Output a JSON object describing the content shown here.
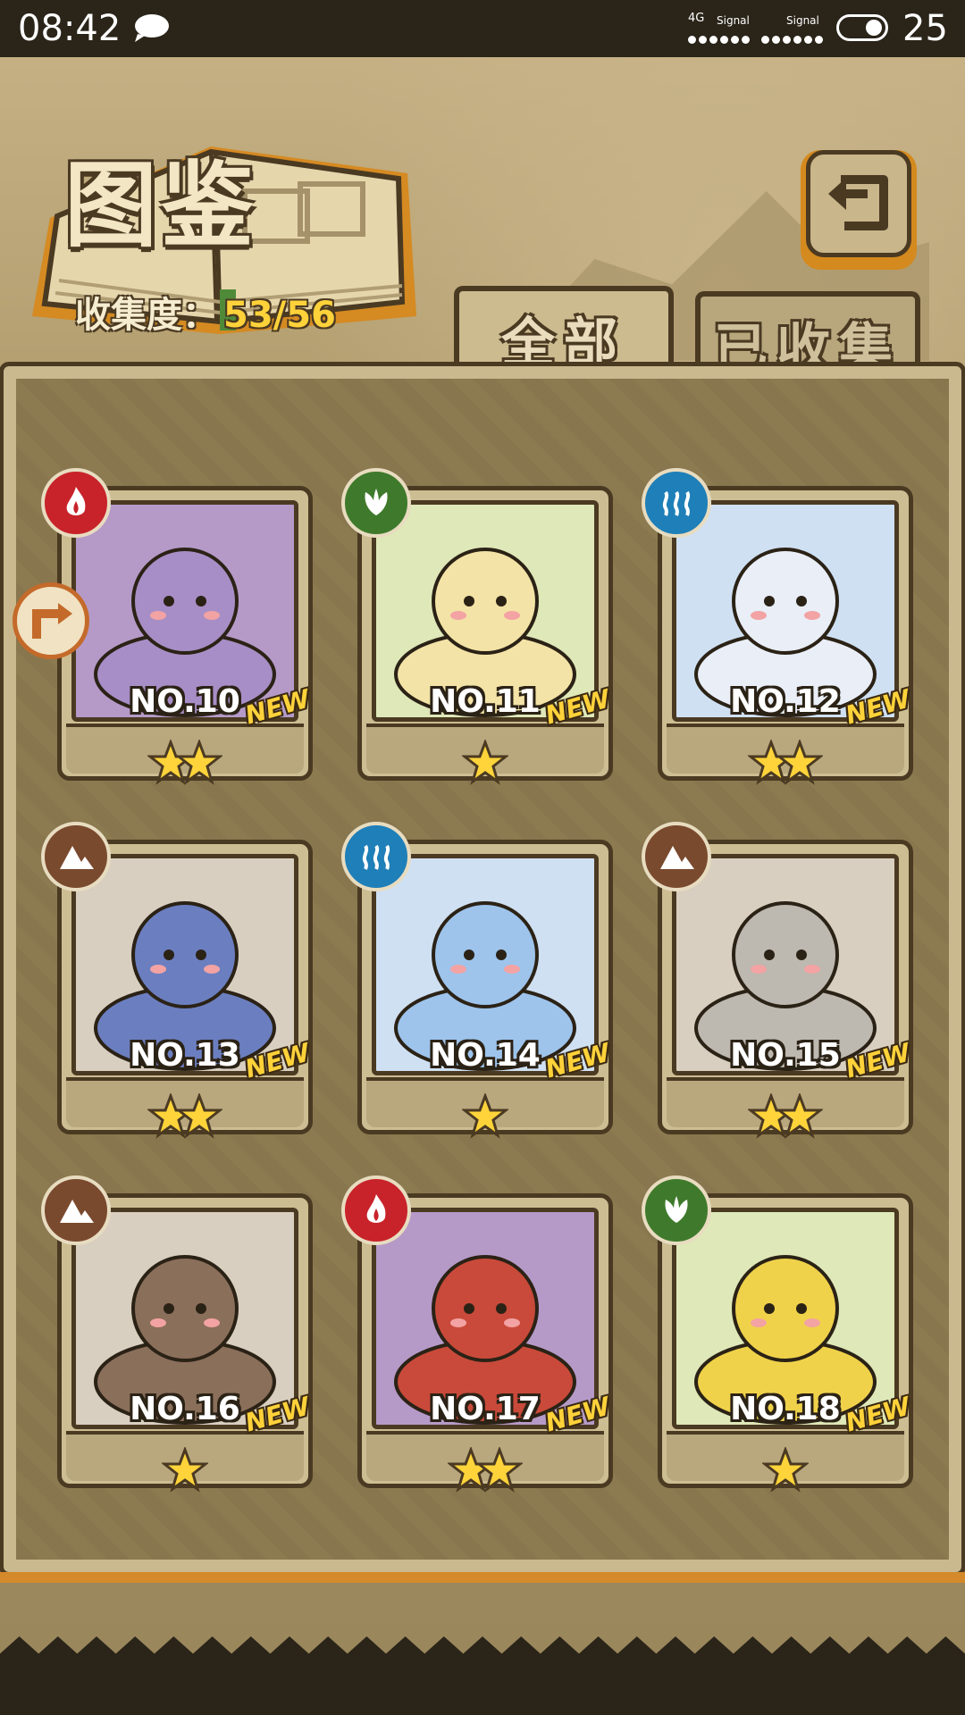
{
  "status_bar": {
    "time": "08:42",
    "network_1": "4G",
    "signal_1": "Signal",
    "signal_2": "Signal",
    "battery_level": "25",
    "icons": [
      "chat-bubble-icon",
      "battery-icon"
    ]
  },
  "header": {
    "title": "图鉴",
    "collection_label": "收集度：",
    "collection_value": "53/56"
  },
  "tabs": [
    {
      "label": "全部",
      "selected": true
    },
    {
      "label": "已收集",
      "selected": false
    }
  ],
  "cards": [
    {
      "number": "NO.10",
      "badge": "NEW",
      "stars": 2,
      "element": "fire"
    },
    {
      "number": "NO.11",
      "badge": "NEW",
      "stars": 1,
      "element": "leaf"
    },
    {
      "number": "NO.12",
      "badge": "NEW",
      "stars": 2,
      "element": "water"
    },
    {
      "number": "NO.13",
      "badge": "NEW",
      "stars": 2,
      "element": "earth"
    },
    {
      "number": "NO.14",
      "badge": "NEW",
      "stars": 1,
      "element": "water"
    },
    {
      "number": "NO.15",
      "badge": "NEW",
      "stars": 2,
      "element": "earth"
    },
    {
      "number": "NO.16",
      "badge": "NEW",
      "stars": 1,
      "element": "earth"
    },
    {
      "number": "NO.17",
      "badge": "NEW",
      "stars": 2,
      "element": "fire"
    },
    {
      "number": "NO.18",
      "badge": "NEW",
      "stars": 1,
      "element": "leaf"
    }
  ],
  "element_colors": {
    "fire": "#c8232a",
    "leaf": "#3f7a2c",
    "water": "#1f7fb8",
    "earth": "#7a4a2e"
  },
  "colors": {
    "accent_gold": "#ffd23a",
    "frame_dark": "#4b3a22",
    "orange_accent": "#d48a1e"
  }
}
